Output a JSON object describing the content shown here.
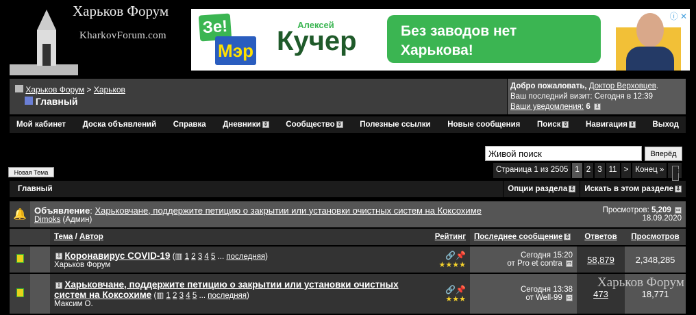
{
  "logo": {
    "title": "Харьков Форум",
    "domain": "KharkovForum.com"
  },
  "ad": {
    "ze": "Зе!",
    "mer": "Мэр",
    "first_name": "Алексей",
    "surname": "Кучер",
    "slogan": "Без заводов нет Харькова!",
    "close": "ⓘ ✕"
  },
  "breadcrumb": {
    "root": "Харьков Форум",
    "sep": ">",
    "parent": "Харьков",
    "current": "Главный"
  },
  "welcome": {
    "greeting": "Добро пожаловать,",
    "user": "Доктор Верховцев",
    "last_visit": "Ваш последний визит: Сегодня в 12:39",
    "notifications_label": "Ваши уведомления:",
    "notifications_count": "6"
  },
  "nav": [
    "Мой кабинет",
    "Доска объявлений",
    "Справка",
    "Дневники",
    "Сообщество",
    "Полезные ссылки",
    "Новые сообщения",
    "Поиск",
    "Навигация",
    "Выход"
  ],
  "search": {
    "value": "Живой поиск",
    "button": "Вперёд"
  },
  "new_topic": "Новая Тема",
  "pager": {
    "label": "Страница 1 из 2505",
    "pages": [
      "1",
      "2",
      "3",
      "11",
      ">",
      "Конец »"
    ]
  },
  "section": {
    "title": "Главный",
    "options": "Опции раздела",
    "search": "Искать в этом разделе"
  },
  "announcement": {
    "label": "Объявление",
    "title": "Харьковчане, поддержите петицию о закрытии или установки очистных систем на Коксохиме",
    "author": "Dimoks",
    "role": "(Админ)",
    "views_label": "Просмотров:",
    "views": "5,209",
    "date": "18.09.2020"
  },
  "columns": {
    "topic": "Тема",
    "author": "Автор",
    "rating": "Рейтинг",
    "last": "Последнее сообщение",
    "replies": "Ответов",
    "views": "Просмотров"
  },
  "threads": [
    {
      "title": "Коронавирус COVID-19",
      "pages": [
        "1",
        "2",
        "3",
        "4",
        "5"
      ],
      "last_label": "последняя",
      "author": "Харьков Форум",
      "stars": "★★★★",
      "last_time": "Сегодня 15:20",
      "last_by": "от Pro et contra",
      "replies": "58,879",
      "views": "2,348,285"
    },
    {
      "title": "Харьковчане, поддержите петицию о закрытии или установки очистных систем на Коксохиме",
      "pages": [
        "1",
        "2",
        "3",
        "4",
        "5"
      ],
      "last_label": "последняя",
      "author": "Максим О.",
      "stars": "★★★",
      "last_time": "Сегодня 13:38",
      "last_by": "от Well-99",
      "replies": "473",
      "views": "18,771"
    }
  ],
  "watermark": "Харьков Форум"
}
